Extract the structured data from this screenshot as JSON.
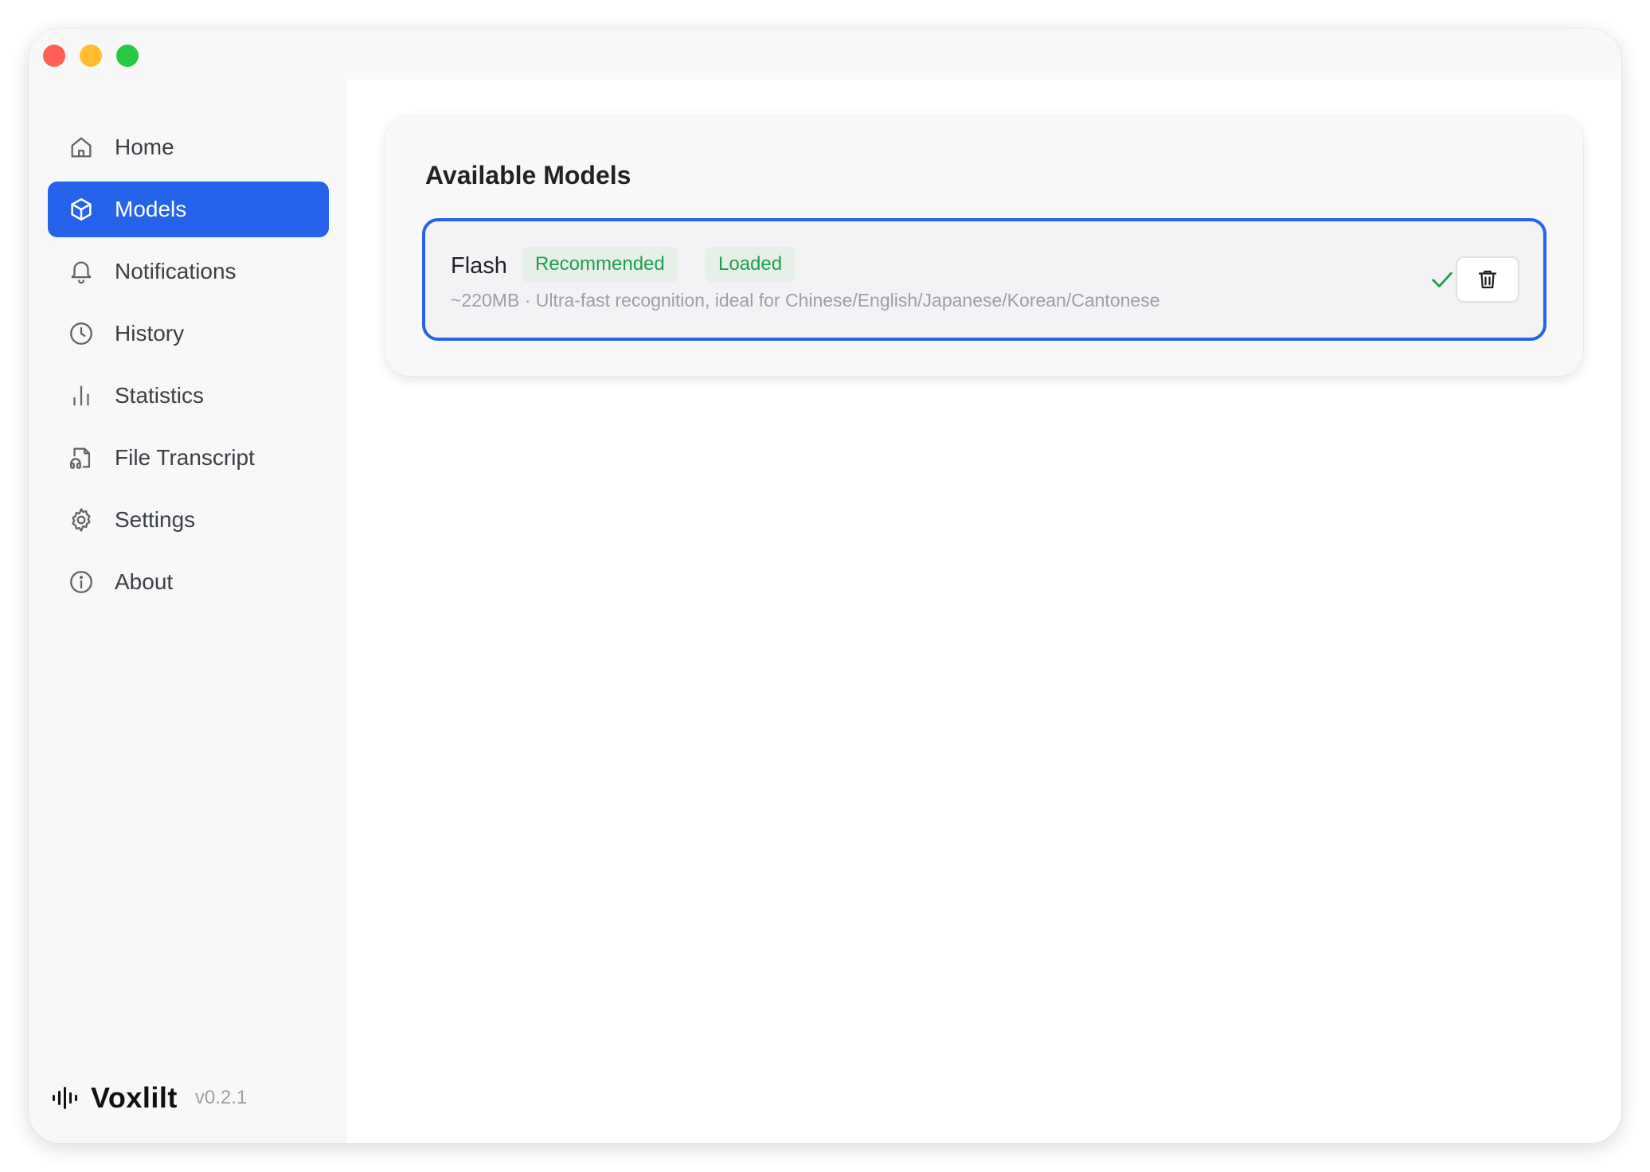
{
  "window": {
    "controls": [
      "close",
      "minimize",
      "maximize"
    ]
  },
  "sidebar": {
    "items": [
      {
        "label": "Home",
        "icon": "home-icon",
        "active": false
      },
      {
        "label": "Models",
        "icon": "box-icon",
        "active": true
      },
      {
        "label": "Notifications",
        "icon": "bell-icon",
        "active": false
      },
      {
        "label": "History",
        "icon": "clock-icon",
        "active": false
      },
      {
        "label": "Statistics",
        "icon": "bar-chart-icon",
        "active": false
      },
      {
        "label": "File Transcript",
        "icon": "file-audio-icon",
        "active": false
      },
      {
        "label": "Settings",
        "icon": "gear-icon",
        "active": false
      },
      {
        "label": "About",
        "icon": "info-icon",
        "active": false
      }
    ],
    "brand": {
      "name": "Voxlilt",
      "version": "v0.2.1"
    }
  },
  "main": {
    "title": "Available Models",
    "models": [
      {
        "name": "Flash",
        "badges": [
          "Recommended",
          "Loaded"
        ],
        "description": "~220MB · Ultra-fast recognition, ideal for Chinese/English/Japanese/Korean/Cantonese",
        "status_icon": "check-icon",
        "action_icon": "trash-icon",
        "selected": true
      }
    ]
  },
  "colors": {
    "accent": "#2563eb",
    "badge_text": "#1e9e4f",
    "badge_bg": "#e6f0e8",
    "sidebar_bg": "#f8f8f8",
    "main_bg": "#ffffff"
  }
}
